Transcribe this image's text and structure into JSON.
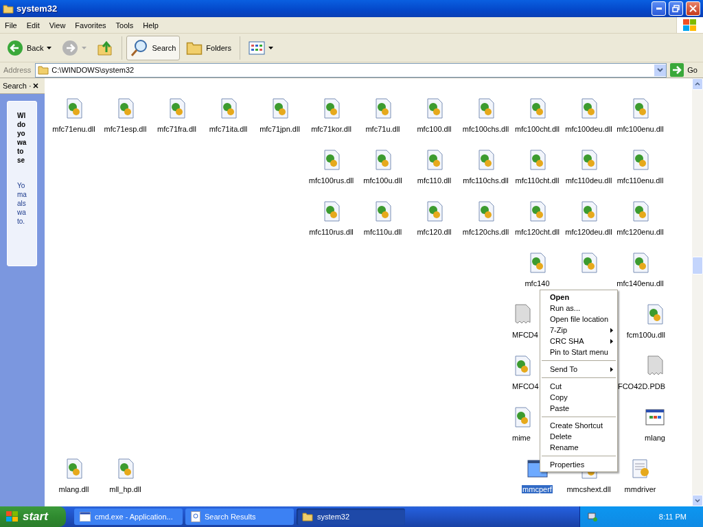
{
  "window": {
    "title": "system32"
  },
  "menu_bar": [
    "File",
    "Edit",
    "View",
    "Favorites",
    "Tools",
    "Help"
  ],
  "toolbar": {
    "back": "Back",
    "search": "Search",
    "folders": "Folders"
  },
  "address": {
    "label": "Address",
    "value": "C:\\WINDOWS\\system32",
    "go": "Go"
  },
  "search_pane": {
    "tab": "Search ·",
    "question": "Wl\ndo\nyo\nwa\nto\nse",
    "hint": "Yo\nma\nals\nwa\nto."
  },
  "files": [
    [
      {
        "name": "mfc71enu.dll",
        "kind": "dll",
        "selected": false
      },
      {
        "name": "mfc71esp.dll",
        "kind": "dll",
        "selected": false
      },
      {
        "name": "mfc71fra.dll",
        "kind": "dll",
        "selected": false
      },
      {
        "name": "mfc71ita.dll",
        "kind": "dll",
        "selected": false
      },
      {
        "name": "mfc71jpn.dll",
        "kind": "dll",
        "selected": false
      },
      {
        "name": "mfc71kor.dll",
        "kind": "dll",
        "selected": false
      },
      {
        "name": "mfc71u.dll",
        "kind": "dll",
        "selected": false
      },
      {
        "name": "mfc100.dll",
        "kind": "dll",
        "selected": false
      },
      {
        "name": "mfc100chs.dll",
        "kind": "dll",
        "selected": false
      },
      {
        "name": "mfc100cht.dll",
        "kind": "dll",
        "selected": false
      },
      {
        "name": "mfc100deu.dll",
        "kind": "dll",
        "selected": false
      },
      {
        "name": "mfc100enu.dll",
        "kind": "dll",
        "selected": false
      }
    ],
    [
      {
        "kind": "empty"
      },
      {
        "kind": "empty"
      },
      {
        "kind": "empty"
      },
      {
        "kind": "empty"
      },
      {
        "kind": "empty"
      },
      {
        "name": "mfc100rus.dll",
        "kind": "dll",
        "selected": false
      },
      {
        "name": "mfc100u.dll",
        "kind": "dll",
        "selected": false
      },
      {
        "name": "mfc110.dll",
        "kind": "dll",
        "selected": false
      },
      {
        "name": "mfc110chs.dll",
        "kind": "dll",
        "selected": false
      },
      {
        "name": "mfc110cht.dll",
        "kind": "dll",
        "selected": false
      },
      {
        "name": "mfc110deu.dll",
        "kind": "dll",
        "selected": false
      },
      {
        "name": "mfc110enu.dll",
        "kind": "dll",
        "selected": false
      }
    ],
    [
      {
        "kind": "empty"
      },
      {
        "kind": "empty"
      },
      {
        "kind": "empty"
      },
      {
        "kind": "empty"
      },
      {
        "kind": "empty"
      },
      {
        "name": "mfc110rus.dll",
        "kind": "dll",
        "selected": false
      },
      {
        "name": "mfc110u.dll",
        "kind": "dll",
        "selected": false
      },
      {
        "name": "mfc120.dll",
        "kind": "dll",
        "selected": false
      },
      {
        "name": "mfc120chs.dll",
        "kind": "dll",
        "selected": false
      },
      {
        "name": "mfc120cht.dll",
        "kind": "dll",
        "selected": false
      },
      {
        "name": "mfc120deu.dll",
        "kind": "dll",
        "selected": false
      },
      {
        "name": "mfc120enu.dll",
        "kind": "dll",
        "selected": false
      }
    ],
    [
      {
        "kind": "empty"
      },
      {
        "kind": "empty"
      },
      {
        "kind": "empty"
      },
      {
        "kind": "empty"
      },
      {
        "kind": "empty"
      },
      {
        "kind": "empty"
      },
      {
        "kind": "empty"
      },
      {
        "kind": "empty"
      },
      {
        "kind": "empty"
      },
      {
        "name": "mfc140",
        "kind": "dll",
        "selected": false
      },
      {
        "kind": "dll",
        "selected": false
      },
      {
        "name": "mfc140enu.dll",
        "kind": "dll",
        "selected": false
      }
    ],
    [
      {
        "kind": "empty"
      },
      {
        "kind": "empty"
      },
      {
        "kind": "empty"
      },
      {
        "kind": "empty"
      },
      {
        "kind": "empty"
      },
      {
        "kind": "empty"
      },
      {
        "kind": "empty"
      },
      {
        "kind": "empty"
      },
      {
        "kind": "empty"
      },
      {
        "name": "MFCD4",
        "kind": "pdb",
        "selected": false
      },
      {
        "kind": "empty"
      },
      {
        "name": "fcm100u.dll",
        "kind": "dll",
        "selected": false
      }
    ],
    [
      {
        "kind": "empty"
      },
      {
        "kind": "empty"
      },
      {
        "kind": "empty"
      },
      {
        "kind": "empty"
      },
      {
        "kind": "empty"
      },
      {
        "kind": "empty"
      },
      {
        "kind": "empty"
      },
      {
        "kind": "empty"
      },
      {
        "kind": "empty"
      },
      {
        "name": "MFCO4",
        "kind": "dll",
        "selected": false
      },
      {
        "kind": "empty"
      },
      {
        "name": "FCO42D.PDB",
        "kind": "pdb",
        "selected": false
      }
    ],
    [
      {
        "kind": "empty"
      },
      {
        "kind": "empty"
      },
      {
        "kind": "empty"
      },
      {
        "kind": "empty"
      },
      {
        "kind": "empty"
      },
      {
        "kind": "empty"
      },
      {
        "kind": "empty"
      },
      {
        "kind": "empty"
      },
      {
        "kind": "empty"
      },
      {
        "name": "mime",
        "kind": "dll",
        "selected": false
      },
      {
        "kind": "empty"
      },
      {
        "name": "mlang",
        "kind": "app",
        "selected": false
      }
    ],
    [
      {
        "name": "mlang.dll",
        "kind": "dll",
        "selected": false
      },
      {
        "name": "mll_hp.dll",
        "kind": "dll",
        "selected": false
      },
      {
        "kind": "empty"
      },
      {
        "kind": "empty"
      },
      {
        "kind": "empty"
      },
      {
        "kind": "empty"
      },
      {
        "kind": "empty"
      },
      {
        "kind": "empty"
      },
      {
        "kind": "empty"
      },
      {
        "name": "mmcperf",
        "kind": "window",
        "selected": true
      },
      {
        "name": "mmcshext.dll",
        "kind": "dll",
        "selected": false
      },
      {
        "name": "mmdriver",
        "kind": "config",
        "selected": false
      }
    ]
  ],
  "context_menu": [
    {
      "kind": "item",
      "label": "Open",
      "default": true,
      "submenu": false
    },
    {
      "kind": "item",
      "label": "Run as...",
      "default": false,
      "submenu": false
    },
    {
      "kind": "item",
      "label": "Open file location",
      "default": false,
      "submenu": false
    },
    {
      "kind": "item",
      "label": "7-Zip",
      "default": false,
      "submenu": true
    },
    {
      "kind": "item",
      "label": "CRC SHA",
      "default": false,
      "submenu": true
    },
    {
      "kind": "item",
      "label": "Pin to Start menu",
      "default": false,
      "submenu": false
    },
    {
      "kind": "separator"
    },
    {
      "kind": "item",
      "label": "Send To",
      "default": false,
      "submenu": true
    },
    {
      "kind": "separator"
    },
    {
      "kind": "item",
      "label": "Cut",
      "default": false,
      "submenu": false
    },
    {
      "kind": "item",
      "label": "Copy",
      "default": false,
      "submenu": false
    },
    {
      "kind": "item",
      "label": "Paste",
      "default": false,
      "submenu": false
    },
    {
      "kind": "separator"
    },
    {
      "kind": "item",
      "label": "Create Shortcut",
      "default": false,
      "submenu": false
    },
    {
      "kind": "item",
      "label": "Delete",
      "default": false,
      "submenu": false
    },
    {
      "kind": "item",
      "label": "Rename",
      "default": false,
      "submenu": false
    },
    {
      "kind": "separator"
    },
    {
      "kind": "item",
      "label": "Properties",
      "default": false,
      "submenu": false
    }
  ],
  "taskbar": {
    "start": "start",
    "tasks": [
      {
        "label": "cmd.exe - Application...",
        "kind": "console",
        "selected": false
      },
      {
        "label": "Search Results",
        "kind": "search",
        "selected": false
      },
      {
        "label": "system32",
        "kind": "folder",
        "selected": true
      }
    ],
    "clock": "8:11 PM"
  }
}
